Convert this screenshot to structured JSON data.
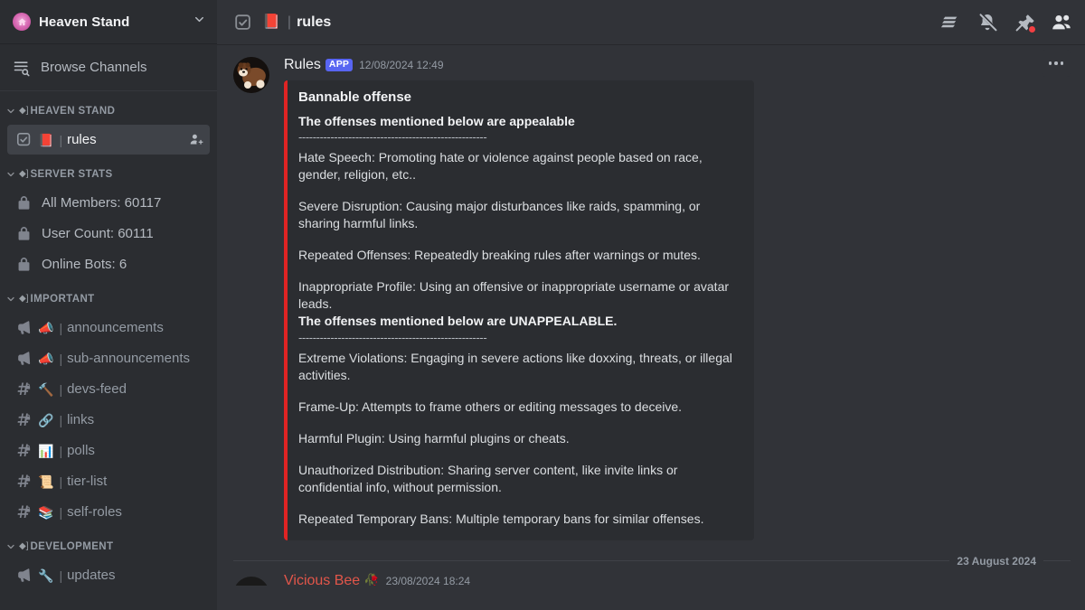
{
  "sidebar": {
    "server": {
      "name": "Heaven Stand",
      "icon": "home-icon",
      "chevron": "chevron-down-icon"
    },
    "browse": {
      "label": "Browse Channels",
      "icon": "browse-channels-icon"
    },
    "categories": [
      {
        "name": "HEAVEN STAND",
        "emoji": "◆]",
        "channels": [
          {
            "name": "rules",
            "emoji": "📕",
            "icon": "rules-channel-icon",
            "active": true,
            "trailing": "add-members-icon"
          }
        ]
      },
      {
        "name": "SERVER STATS",
        "emoji": "◆]",
        "channels": [
          {
            "name": "All Members: 60117",
            "icon": "lock-icon",
            "stat": true
          },
          {
            "name": "User Count: 60111",
            "icon": "lock-icon",
            "stat": true
          },
          {
            "name": "Online Bots: 6",
            "icon": "lock-icon",
            "stat": true
          }
        ]
      },
      {
        "name": "IMPORTANT",
        "emoji": "◆]",
        "channels": [
          {
            "name": "announcements",
            "emoji": "📣",
            "icon": "announcement-channel-icon"
          },
          {
            "name": "sub-announcements",
            "emoji": "📣",
            "icon": "announcement-channel-icon"
          },
          {
            "name": "devs-feed",
            "emoji": "🔨",
            "icon": "locked-text-channel-icon"
          },
          {
            "name": "links",
            "emoji": "🔗",
            "icon": "locked-text-channel-icon"
          },
          {
            "name": "polls",
            "emoji": "📊",
            "icon": "locked-text-channel-icon"
          },
          {
            "name": "tier-list",
            "emoji": "📜",
            "icon": "locked-text-channel-icon"
          },
          {
            "name": "self-roles",
            "emoji": "📚",
            "icon": "locked-text-channel-icon"
          }
        ]
      },
      {
        "name": "DEVELOPMENT",
        "emoji": "◆]",
        "channels": [
          {
            "name": "updates",
            "emoji": "🔧",
            "icon": "announcement-channel-icon"
          }
        ]
      }
    ]
  },
  "topbar": {
    "channel_name": "rules",
    "channel_emoji": "📕",
    "channel_icon": "rules-channel-icon",
    "pipe": "|",
    "actions": [
      {
        "name": "threads-icon"
      },
      {
        "name": "notifications-muted-icon"
      },
      {
        "name": "pinned-messages-icon",
        "badge": true
      },
      {
        "name": "member-list-icon"
      }
    ]
  },
  "message": {
    "author": "Rules",
    "badge": "APP",
    "timestamp": "12/08/2024 12:49",
    "more_options": "more-options-icon",
    "embed": {
      "accent_color": "#e02424",
      "title": "Bannable offense",
      "section_one_heading": "The offenses mentioned below are appealable",
      "divider": "-----------------------------------------------------",
      "section_one_items": [
        "Hate Speech: Promoting hate or violence against people based on race, gender, religion, etc..",
        "Severe Disruption: Causing major disturbances like raids, spamming, or sharing harmful links.",
        "Repeated Offenses: Repeatedly breaking rules after warnings or mutes.",
        "Inappropriate Profile: Using an offensive or inappropriate username or avatar leads."
      ],
      "section_two_heading": "The offenses mentioned below are UNAPPEALABLE.",
      "section_two_items": [
        "Extreme Violations: Engaging in severe actions like doxxing, threats, or illegal activities.",
        "Frame-Up: Attempts to frame others or editing messages to deceive.",
        "Harmful Plugin: Using harmful plugins or cheats.",
        "Unauthorized Distribution: Sharing server content, like invite links or confidential info, without permission.",
        "Repeated Temporary Bans: Multiple temporary bans for similar offenses."
      ]
    }
  },
  "date_divider": {
    "label": "23 August 2024"
  },
  "next_message": {
    "author": "Vicious Bee",
    "emoji": "🥀",
    "timestamp": "23/08/2024 18:24"
  }
}
